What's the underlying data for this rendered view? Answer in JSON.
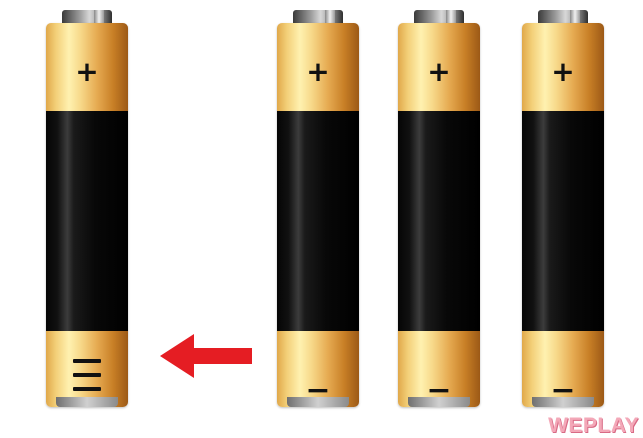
{
  "scene": {
    "description_label": "battery-polarity-illustration",
    "batteries": [
      {
        "id": "left",
        "top_symbol": "+",
        "bottom_symbol": "≡",
        "bottom_style": "three-lines"
      },
      {
        "id": "middle-1",
        "top_symbol": "+",
        "bottom_symbol": "−",
        "bottom_style": "minus"
      },
      {
        "id": "middle-2",
        "top_symbol": "+",
        "bottom_symbol": "−",
        "bottom_style": "minus"
      },
      {
        "id": "right",
        "top_symbol": "+",
        "bottom_symbol": "−",
        "bottom_style": "minus"
      }
    ],
    "arrow": {
      "direction": "left",
      "color": "#e51d23"
    },
    "watermark": "WEPLAY",
    "colors": {
      "gold": "#f3cf78",
      "black": "#000000",
      "arrow": "#e51d23",
      "watermark": "#f3a8b8"
    }
  }
}
